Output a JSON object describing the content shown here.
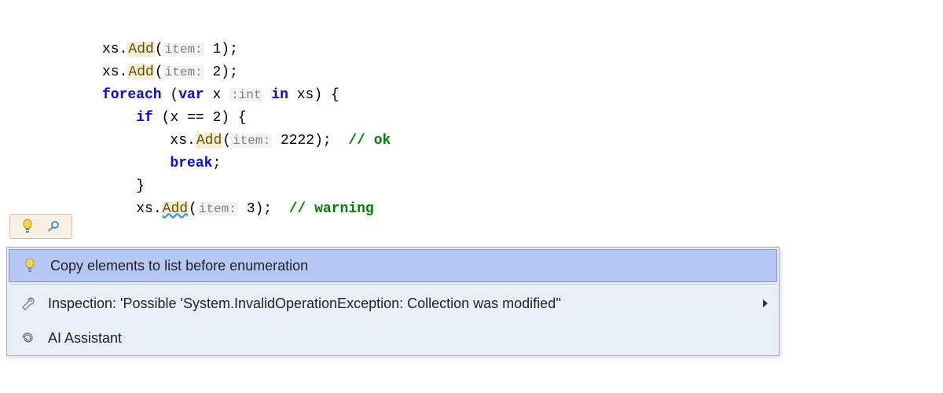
{
  "code": {
    "line1_var": "xs",
    "line1_method": "Add",
    "line1_hint": "item:",
    "line1_arg": "1",
    "line2_var": "xs",
    "line2_method": "Add",
    "line2_hint": "item:",
    "line2_arg": "2",
    "line3_kw_foreach": "foreach",
    "line3_kw_var": "var",
    "line3_var": "x",
    "line3_hint": ":int",
    "line3_kw_in": "in",
    "line3_coll": "xs",
    "line4_kw_if": "if",
    "line4_cond_left": "x",
    "line4_cond_op": "==",
    "line4_cond_right": "2",
    "line5_var": "xs",
    "line5_method": "Add",
    "line5_hint": "item:",
    "line5_arg": "2222",
    "line5_comment": "// ok",
    "line6_kw_break": "break",
    "line9_var": "xs",
    "line9_method": "Add",
    "line9_hint": "item:",
    "line9_arg": "3",
    "line9_comment": "// warning"
  },
  "menu": {
    "item1": "Copy elements to list before enumeration",
    "item2": "Inspection: 'Possible 'System.InvalidOperationException: Collection was modified''",
    "item3": "AI Assistant"
  }
}
